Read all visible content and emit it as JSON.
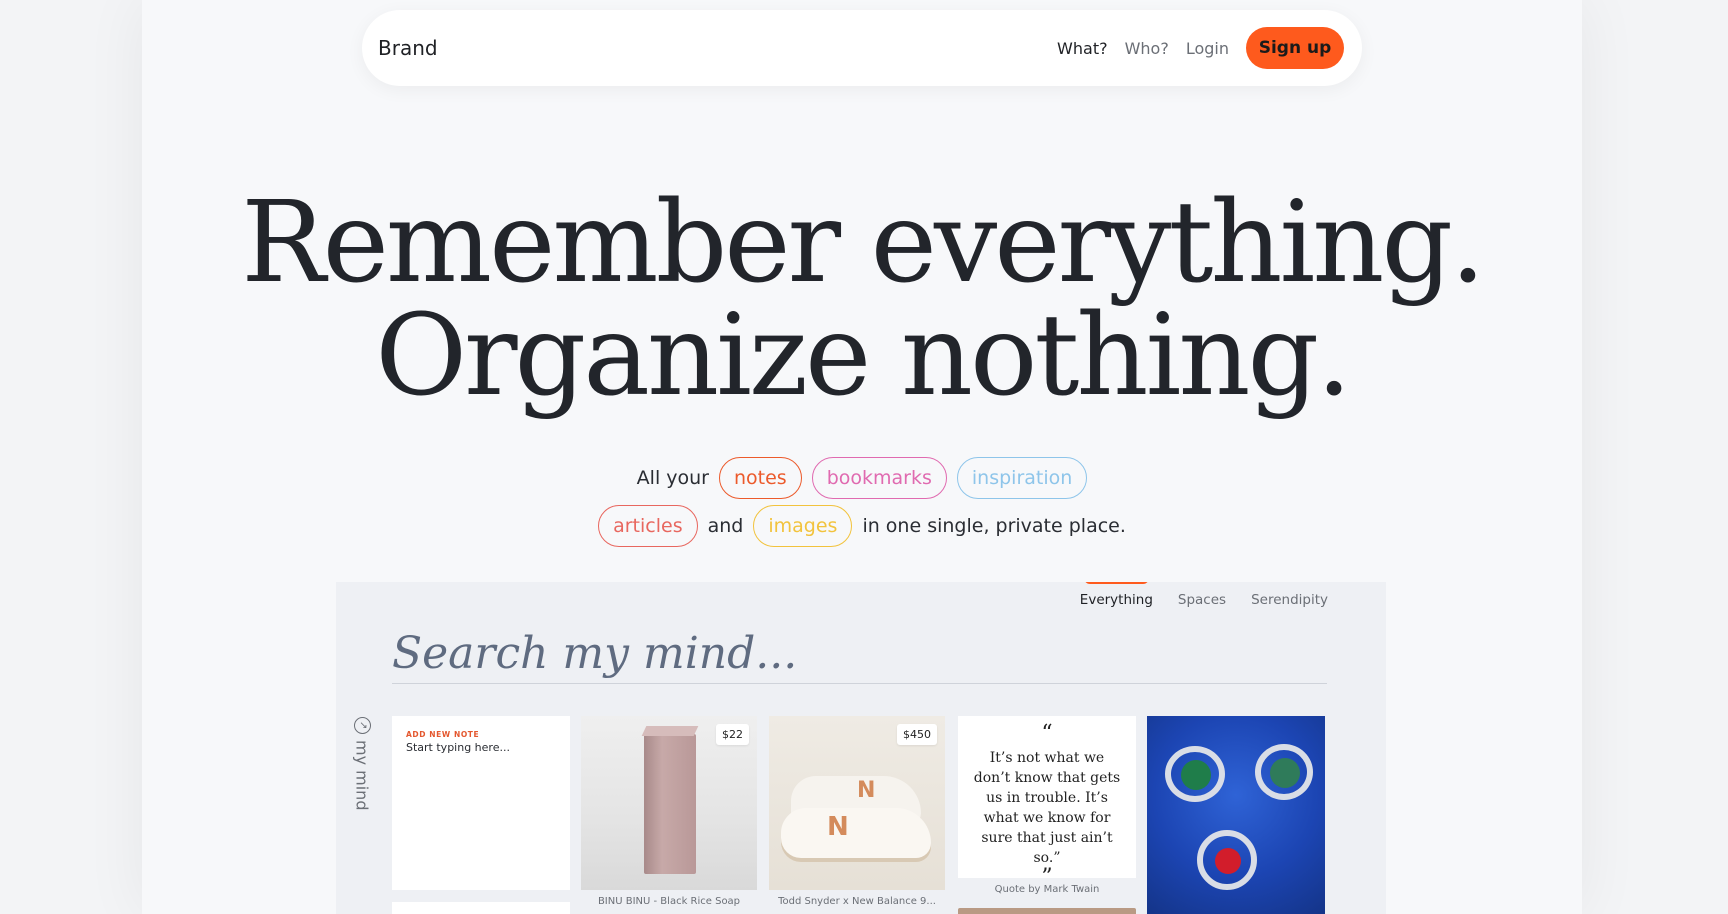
{
  "nav": {
    "brand": "Brand",
    "links": [
      "What?",
      "Who?",
      "Login"
    ],
    "signup": "Sign up"
  },
  "hero": {
    "line1": "Remember everything.",
    "line2": "Organize nothing."
  },
  "tagline": {
    "prefix": "All your",
    "pills": [
      {
        "label": "notes",
        "color": "#ec5a2b"
      },
      {
        "label": "bookmarks",
        "color": "#e06ab0"
      },
      {
        "label": "inspiration",
        "color": "#8ec5ea"
      },
      {
        "label": "articles",
        "color": "#e8675f"
      },
      {
        "label": "images",
        "color": "#f2c33d"
      }
    ],
    "and": "and",
    "suffix": "in one single, private place."
  },
  "app": {
    "tabs": [
      "Everything",
      "Spaces",
      "Serendipity"
    ],
    "active_tab": "Everything",
    "search_placeholder": "Search my mind...",
    "side_logo": "my mind",
    "note": {
      "label": "ADD NEW NOTE",
      "placeholder": "Start typing here..."
    },
    "cards": [
      {
        "price": "$22",
        "caption": "BINU BINU - Black Rice Soap"
      },
      {
        "price": "$450",
        "caption": "Todd Snyder x New Balance 9..."
      }
    ],
    "quote": {
      "open": "“",
      "text": "It’s not what we don’t know that gets us in trouble. It’s what we know for sure that just ain’t so.”",
      "close": "”",
      "caption": "Quote by Mark Twain"
    }
  },
  "colors": {
    "accent": "#fe5a1d",
    "background": "#f7f8fa"
  }
}
